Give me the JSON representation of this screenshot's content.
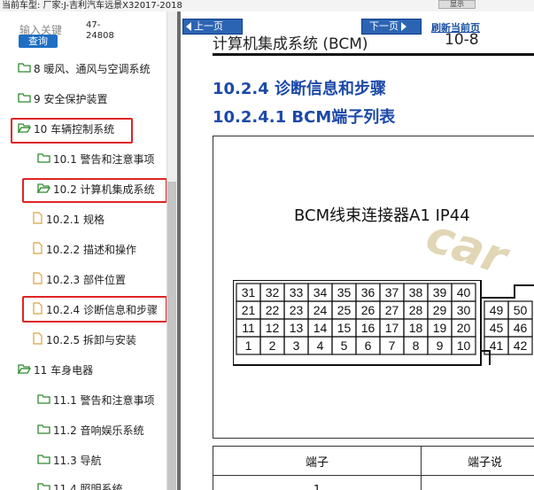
{
  "topbar": {
    "title": "当前车型:   厂家:J-吉利汽车远景X32017-2018",
    "right_label": "显示"
  },
  "search": {
    "label": "输入关键",
    "button": "查询",
    "count": "47-24808"
  },
  "tree": [
    {
      "label": "8 暖风、通风与空调系统",
      "icon": "folder-icon"
    },
    {
      "label": "9 安全保护装置",
      "icon": "folder-icon"
    },
    {
      "label": "10 车辆控制系统",
      "icon": "folder-open-icon"
    },
    {
      "label": "10.1 警告和注意事项",
      "icon": "folder-icon"
    },
    {
      "label": "10.2 计算机集成系统",
      "icon": "folder-open-icon"
    },
    {
      "label": "10.2.1 规格",
      "icon": "document-icon"
    },
    {
      "label": "10.2.2 描述和操作",
      "icon": "document-icon"
    },
    {
      "label": "10.2.3 部件位置",
      "icon": "document-icon"
    },
    {
      "label": "10.2.4 诊断信息和步骤",
      "icon": "document-icon"
    },
    {
      "label": "10.2.5 拆卸与安装",
      "icon": "document-icon"
    },
    {
      "label": "11 车身电器",
      "icon": "folder-icon"
    },
    {
      "label": "11.1 警告和注意事项",
      "icon": "folder-icon"
    },
    {
      "label": "11.2 音响娱乐系统",
      "icon": "folder-icon"
    },
    {
      "label": "11.3 导航",
      "icon": "folder-icon"
    },
    {
      "label": "11.4 照明系统",
      "icon": "folder-icon"
    }
  ],
  "nav": {
    "prev": "上一页",
    "next": "下一页",
    "refresh": "刷新当前页"
  },
  "doc": {
    "header": "计算机集成系统 (BCM)",
    "page_no": "10-8",
    "heading1": "10.2.4 诊断信息和步骤",
    "heading2": "10.2.4.1 BCM端子列表",
    "figure_title": "BCM线束连接器A1    IP44",
    "watermark": "car",
    "connector_rows": [
      [
        "31",
        "32",
        "33",
        "34",
        "35",
        "36",
        "37",
        "38",
        "39",
        "40"
      ],
      [
        "21",
        "22",
        "23",
        "24",
        "25",
        "26",
        "27",
        "28",
        "29",
        "30"
      ],
      [
        "11",
        "12",
        "13",
        "14",
        "15",
        "16",
        "17",
        "18",
        "19",
        "20"
      ],
      [
        "1",
        "2",
        "3",
        "4",
        "5",
        "6",
        "7",
        "8",
        "9",
        "10"
      ]
    ],
    "connector_right": [
      [
        "49",
        "50"
      ],
      [
        "45",
        "46"
      ],
      [
        "41",
        "42"
      ]
    ],
    "table_headers": [
      "端子",
      "端子说"
    ],
    "table_row1": [
      "1",
      ""
    ]
  },
  "colors": {
    "accent": "#1c49a8",
    "highlight": "#e02424",
    "button": "#2c64b4"
  }
}
